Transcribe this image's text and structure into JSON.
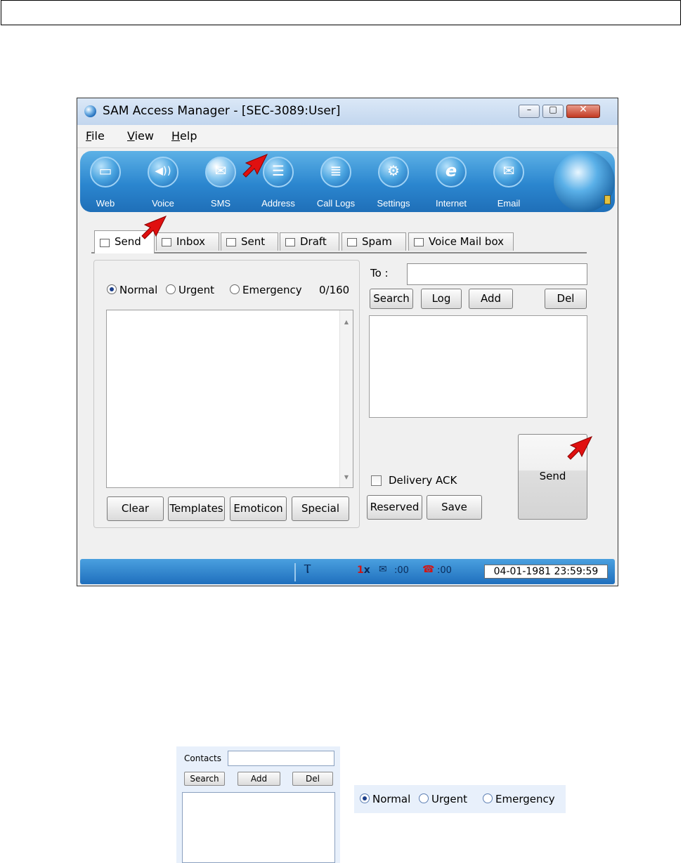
{
  "window": {
    "title": "SAM Access Manager - [SEC-3089:User]",
    "controls": {
      "minimize": "–",
      "maximize": "▢",
      "close": "✕"
    }
  },
  "menu": [
    {
      "label": "File",
      "mnemonic": "F",
      "rest": "ile"
    },
    {
      "label": "View",
      "mnemonic": "V",
      "rest": "iew"
    },
    {
      "label": "Help",
      "mnemonic": "H",
      "rest": "elp"
    }
  ],
  "toolbar": {
    "items": [
      {
        "label": "Web",
        "icon": "web-icon",
        "glyph": "▭"
      },
      {
        "label": "Voice",
        "icon": "speaker-icon",
        "glyph": "◀))"
      },
      {
        "label": "SMS",
        "icon": "envelope-icon",
        "glyph": "✉",
        "active": true
      },
      {
        "label": "Address",
        "icon": "address-book-icon",
        "glyph": "☰"
      },
      {
        "label": "Call Logs",
        "icon": "call-logs-icon",
        "glyph": "≣"
      },
      {
        "label": "Settings",
        "icon": "gear-icon",
        "glyph": "⚙"
      },
      {
        "label": "Internet",
        "icon": "internet-explorer-icon",
        "glyph": "e"
      },
      {
        "label": "Email",
        "icon": "email-icon",
        "glyph": "✉"
      }
    ]
  },
  "tabs": [
    {
      "label": "Send",
      "icon": "envelope-icon",
      "active": true
    },
    {
      "label": "Inbox",
      "icon": "inbox-icon"
    },
    {
      "label": "Sent",
      "icon": "sent-icon"
    },
    {
      "label": "Draft",
      "icon": "draft-icon"
    },
    {
      "label": "Spam",
      "icon": "spam-icon"
    },
    {
      "label": "Voice Mail box",
      "icon": "voicemail-icon"
    }
  ],
  "compose": {
    "priority": {
      "options": [
        "Normal",
        "Urgent",
        "Emergency"
      ],
      "selected": "Normal"
    },
    "counter": "0/160",
    "message": "",
    "buttons": {
      "clear": "Clear",
      "templates": "Templates",
      "emoticon": "Emoticon",
      "special": "Special"
    }
  },
  "recipients": {
    "to_label": "To :",
    "to_value": "",
    "buttons": {
      "search": "Search",
      "log": "Log",
      "add": "Add",
      "del": "Del"
    }
  },
  "options": {
    "delivery_ack_label": "Delivery ACK",
    "delivery_ack_checked": false,
    "reserved": "Reserved",
    "save": "Save",
    "send": "Send"
  },
  "statusbar": {
    "signal_icon": "antenna-icon",
    "network": "1",
    "network_suffix": "x",
    "messages_count": ":00",
    "voicemail_count": ":00",
    "datetime": "04-01-1981 23:59:59"
  },
  "colors": {
    "toolbar": "#2b86cf",
    "annotation_arrow": "#e01010",
    "status_text": "#0a2b5a"
  },
  "crop_contacts": {
    "label": "Contacts",
    "value": "",
    "buttons": {
      "search": "Search",
      "add": "Add",
      "del": "Del"
    }
  },
  "crop_priority": {
    "options": [
      "Normal",
      "Urgent",
      "Emergency"
    ],
    "selected": "Normal"
  }
}
